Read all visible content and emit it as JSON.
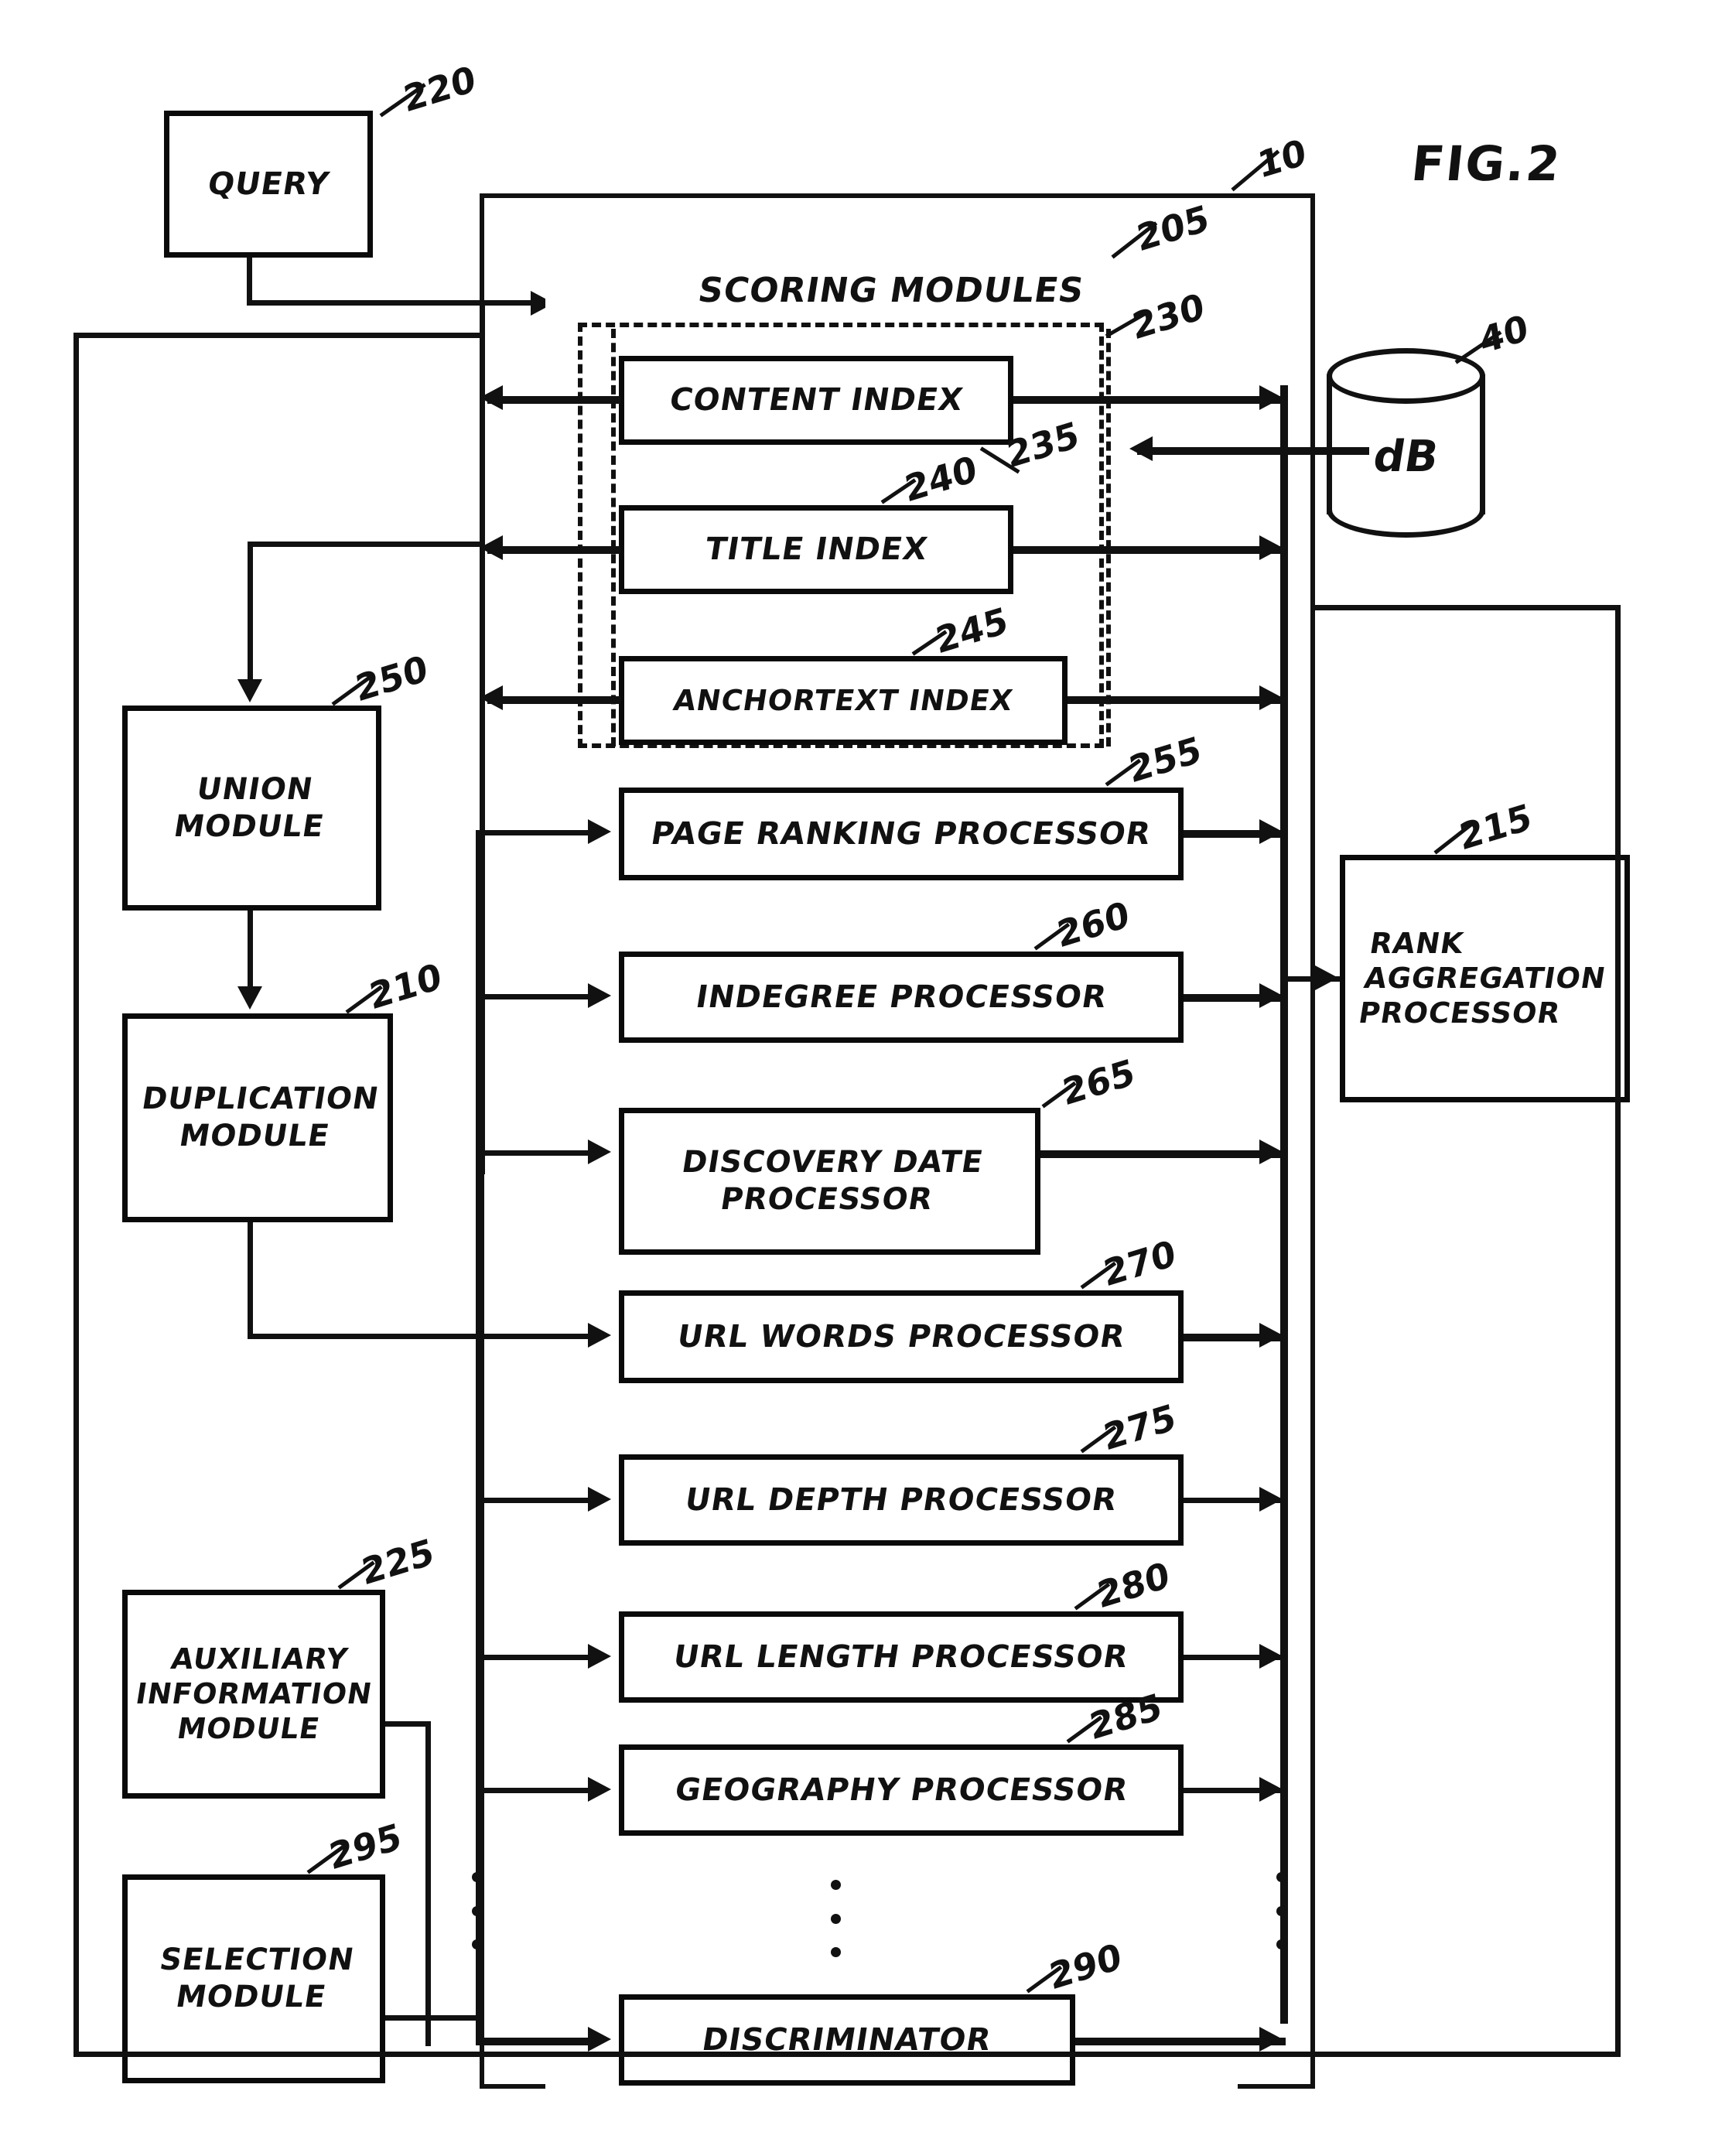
{
  "figure": {
    "title": "FIG.2",
    "system_ref": "10"
  },
  "blocks": {
    "query": {
      "label": "QUERY",
      "ref": "220"
    },
    "scoring_modules": {
      "label": "SCORING MODULES",
      "ref": "205"
    },
    "index_group": {
      "ref": "230"
    },
    "content_index": {
      "label": "CONTENT INDEX",
      "ref": "235"
    },
    "title_index": {
      "label": "TITLE INDEX",
      "ref": "240"
    },
    "anchortext_index": {
      "label": "ANCHORTEXT INDEX",
      "ref": "245"
    },
    "page_ranking_processor": {
      "label": "PAGE RANKING PROCESSOR",
      "ref": "255"
    },
    "indegree_processor": {
      "label": "INDEGREE PROCESSOR",
      "ref": "260"
    },
    "discovery_date_processor": {
      "line1": "DISCOVERY DATE",
      "line2": "PROCESSOR",
      "ref": "265"
    },
    "url_words_processor": {
      "label": "URL WORDS PROCESSOR",
      "ref": "270"
    },
    "url_depth_processor": {
      "label": "URL DEPTH PROCESSOR",
      "ref": "275"
    },
    "url_length_processor": {
      "label": "URL LENGTH PROCESSOR",
      "ref": "280"
    },
    "geography_processor": {
      "label": "GEOGRAPHY PROCESSOR",
      "ref": "285"
    },
    "discriminator": {
      "label": "DISCRIMINATOR",
      "ref": "290"
    },
    "union_module": {
      "line1": "UNION",
      "line2": "MODULE",
      "ref": "250"
    },
    "duplication_module": {
      "line1": "DUPLICATION",
      "line2": "MODULE",
      "ref": "210"
    },
    "auxiliary_information_module": {
      "line1": "AUXILIARY",
      "line2": "INFORMATION",
      "line3": "MODULE",
      "ref": "225"
    },
    "selection_module": {
      "line1": "SELECTION",
      "line2": "MODULE",
      "ref": "295"
    },
    "database": {
      "label": "dB",
      "ref": "40"
    },
    "rank_aggregation_processor": {
      "line1": "RANK",
      "line2": "AGGREGATION",
      "line3": "PROCESSOR",
      "ref": "215"
    }
  },
  "colors": {
    "ink": "#111111",
    "paper": "#ffffff"
  }
}
